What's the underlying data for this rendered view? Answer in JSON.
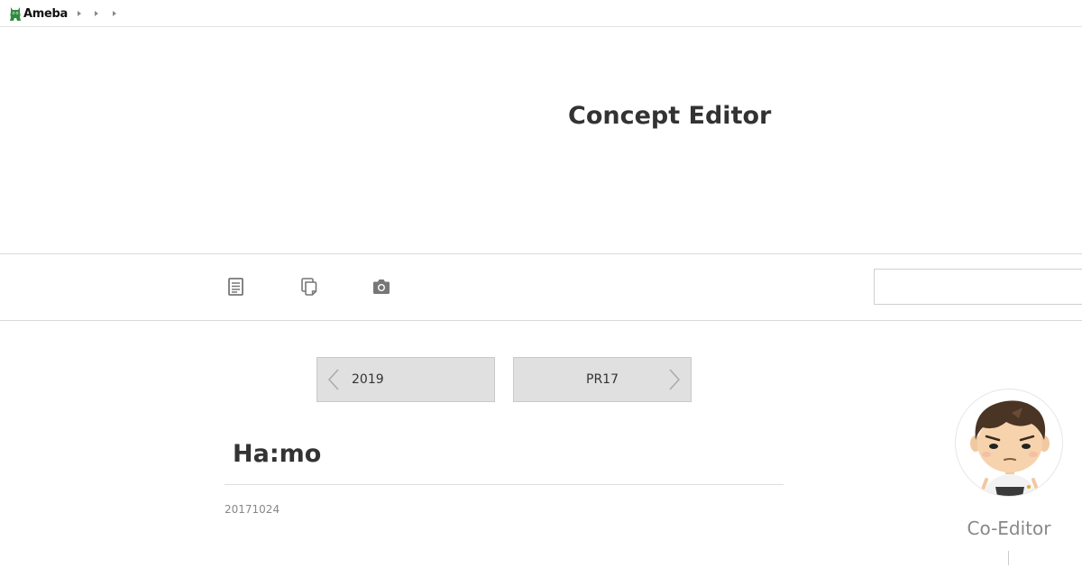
{
  "app": {
    "logo_text": "Ameba",
    "accent_color": "#2d8c3c"
  },
  "header": {
    "blog_title": "Concept Editor"
  },
  "nav": {
    "icons": [
      "entry-list-icon",
      "archive-icon",
      "camera-icon"
    ],
    "search": {
      "value": "",
      "placeholder": ""
    }
  },
  "pager": {
    "prev_label": "2019",
    "next_label": "PR17"
  },
  "entry": {
    "title": "Ha:mo",
    "date": "20171024"
  },
  "profile": {
    "name": "Co-Editor"
  }
}
